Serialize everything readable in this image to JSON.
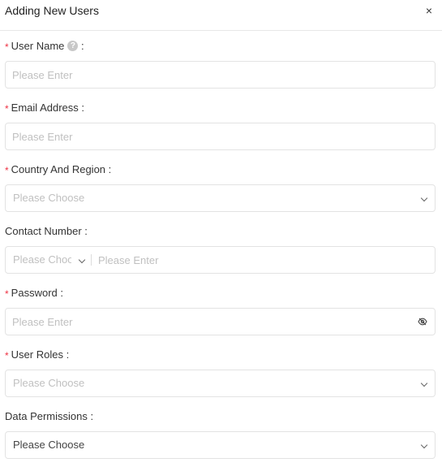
{
  "dialog": {
    "title": "Adding New Users",
    "close_glyph": "×"
  },
  "form": {
    "required_mark": "*",
    "user_name": {
      "label": "User Name",
      "suffix": ":",
      "help_glyph": "?",
      "placeholder": "Please Enter"
    },
    "email": {
      "label": "Email Address :",
      "placeholder": "Please Enter"
    },
    "country": {
      "label": "Country And Region :",
      "placeholder": "Please Choose"
    },
    "contact": {
      "label": "Contact Number :",
      "code_placeholder": "Please Choose",
      "number_placeholder": "Please Enter"
    },
    "password": {
      "label": "Password :",
      "placeholder": "Please Enter",
      "toggle_icon": "eye-slash-icon"
    },
    "roles": {
      "label": "User Roles :",
      "placeholder": "Please Choose"
    },
    "permissions": {
      "label": "Data Permissions :",
      "value": "Please Choose"
    }
  },
  "colors": {
    "required": "#ee3344",
    "border": "#e3e3e3",
    "placeholder": "#c0c0c0"
  }
}
